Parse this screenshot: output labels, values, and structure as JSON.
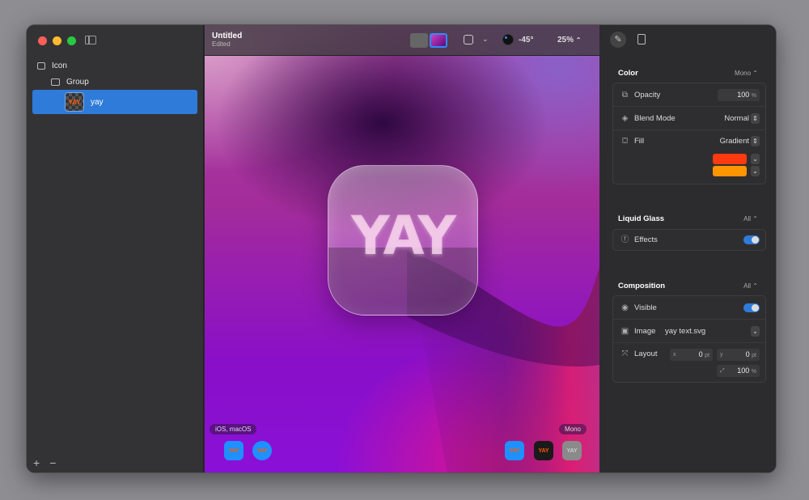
{
  "sidebar": {
    "items": [
      {
        "label": "Icon",
        "icon": "square-icon"
      },
      {
        "label": "Group",
        "icon": "folder-icon"
      },
      {
        "label": "yay",
        "icon": "thumbnail",
        "thumb_text": "YAY"
      }
    ],
    "add_label": "+",
    "remove_label": "−"
  },
  "toolbar": {
    "title": "Untitled",
    "subtitle": "Edited",
    "light_angle": "-45°",
    "zoom": "25%"
  },
  "canvas": {
    "icon_text": "YAY",
    "left_pill": "iOS, macOS",
    "right_pill": "Mono",
    "mini_text": "YAY"
  },
  "inspector": {
    "color": {
      "title": "Color",
      "mode": "Mono",
      "opacity_label": "Opacity",
      "opacity_value": "100",
      "opacity_unit": "%",
      "blend_label": "Blend Mode",
      "blend_value": "Normal",
      "fill_label": "Fill",
      "fill_value": "Gradient",
      "stops": [
        "#ff3a10",
        "#ff9500"
      ]
    },
    "glass": {
      "title": "Liquid Glass",
      "mode": "All",
      "effects_label": "Effects",
      "effects_on": true
    },
    "composition": {
      "title": "Composition",
      "mode": "All",
      "visible_label": "Visible",
      "visible_on": true,
      "image_label": "Image",
      "image_value": "yay text.svg",
      "layout_label": "Layout",
      "x_label": "x",
      "x_value": "0",
      "y_label": "y",
      "y_value": "0",
      "unit": "pt",
      "scale_value": "100",
      "scale_unit": "%"
    }
  },
  "colors": {
    "accent": "#2f7bd9"
  }
}
